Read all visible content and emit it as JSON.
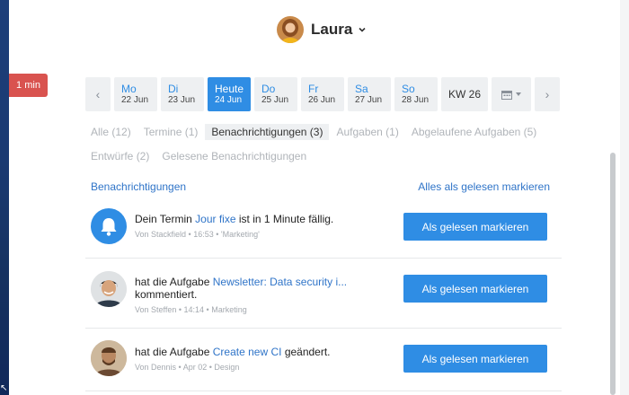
{
  "timer": {
    "label": "1 min"
  },
  "user": {
    "name": "Laura"
  },
  "date_nav": {
    "days": [
      {
        "name": "Mo",
        "date": "22 Jun"
      },
      {
        "name": "Di",
        "date": "23 Jun"
      },
      {
        "name": "Heute",
        "date": "24 Jun"
      },
      {
        "name": "Do",
        "date": "25 Jun"
      },
      {
        "name": "Fr",
        "date": "26 Jun"
      },
      {
        "name": "Sa",
        "date": "27 Jun"
      },
      {
        "name": "So",
        "date": "28 Jun"
      }
    ],
    "week_label": "KW 26"
  },
  "filters": {
    "tabs": [
      "Alle (12)",
      "Termine (1)",
      "Benachrichtigungen (3)",
      "Aufgaben (1)",
      "Abgelaufene Aufgaben (5)",
      "Entwürfe (2)",
      "Gelesene Benachrichtigungen"
    ],
    "active": "Benachrichtigungen (3)"
  },
  "section": {
    "title": "Benachrichtigungen",
    "mark_all": "Alles als gelesen markieren"
  },
  "notifications": [
    {
      "pre": "Dein Termin",
      "link": "Jour fixe",
      "post": "ist in 1 Minute fällig.",
      "meta": "Von Stackfield • 16:53 • 'Marketing'",
      "button": "Als gelesen markieren",
      "icon": "bell-icon"
    },
    {
      "pre": "hat die Aufgabe",
      "link": "Newsletter: Data security i...",
      "post": "kommentiert.",
      "meta": "Von Steffen • 14:14 • Marketing",
      "button": "Als gelesen markieren",
      "icon": "avatar-steffen"
    },
    {
      "pre": "hat die Aufgabe",
      "link": "Create new CI",
      "post": "geändert.",
      "meta": "Von Dennis • Apr 02 • Design",
      "button": "Als gelesen markieren",
      "icon": "avatar-dennis"
    }
  ],
  "colors": {
    "accent": "#2f8de4",
    "link": "#2f74c8",
    "timer_badge": "#d9534f",
    "muted": "#b0b4b9"
  }
}
